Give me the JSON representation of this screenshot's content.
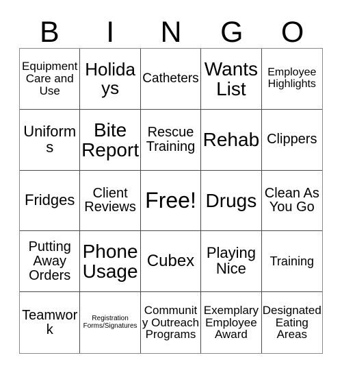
{
  "card": {
    "header_letters": [
      "B",
      "I",
      "N",
      "G",
      "O"
    ],
    "grid_size": "5x5",
    "free_space": "Free!",
    "colors": {
      "background": "#ffffff",
      "cell_background": "#ffffff",
      "text": "#000000",
      "inner_border": "#4a4a4a",
      "outer_border": "#8a8a8a"
    },
    "rows": [
      [
        {
          "text": "Equipment Care and Use",
          "size": "s17"
        },
        {
          "text": "Holidays",
          "size": "s26"
        },
        {
          "text": "Catheters",
          "size": "s19"
        },
        {
          "text": "Wants List",
          "size": "s28"
        },
        {
          "text": "Employee Highlights",
          "size": "s16"
        }
      ],
      [
        {
          "text": "Uniforms",
          "size": "s22"
        },
        {
          "text": "Bite Report",
          "size": "s28"
        },
        {
          "text": "Rescue Training",
          "size": "s20"
        },
        {
          "text": "Rehab",
          "size": "s28"
        },
        {
          "text": "Clippers",
          "size": "s20"
        }
      ],
      [
        {
          "text": "Fridges",
          "size": "s22"
        },
        {
          "text": "Client Reviews",
          "size": "s20"
        },
        {
          "text": "Free!",
          "size": "s32"
        },
        {
          "text": "Drugs",
          "size": "s28"
        },
        {
          "text": "Clean As You Go",
          "size": "s20"
        }
      ],
      [
        {
          "text": "Putting Away Orders",
          "size": "s20"
        },
        {
          "text": "Phone Usage",
          "size": "s28"
        },
        {
          "text": "Cubex",
          "size": "s24"
        },
        {
          "text": "Playing Nice",
          "size": "s22"
        },
        {
          "text": "Training",
          "size": "s18"
        }
      ],
      [
        {
          "text": "Teamwork",
          "size": "s20"
        },
        {
          "text": "Registration Forms/Signatures",
          "size": "s10"
        },
        {
          "text": "Community Outreach Programs",
          "size": "s17"
        },
        {
          "text": "Exemplary Employee Award",
          "size": "s17"
        },
        {
          "text": "Designated Eating Areas",
          "size": "s17"
        }
      ]
    ]
  }
}
